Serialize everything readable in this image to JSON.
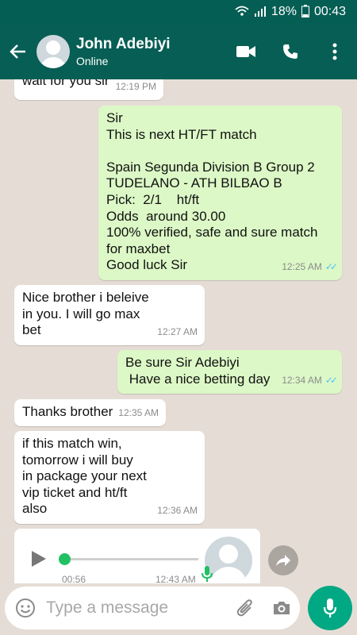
{
  "status_bar": {
    "battery": "18%",
    "time": "00:43"
  },
  "header": {
    "contact_name": "John Adebiyi",
    "status": "Online"
  },
  "messages": [
    {
      "dir": "in",
      "text": "wait for you sir",
      "time": "12:19 PM"
    },
    {
      "dir": "out",
      "text": "Sir\nThis is next HT/FT match\n\nSpain Segunda Division B Group 2\nTUDELANO - ATH BILBAO B\nPick:  2/1    ht/ft\nOdds  around 30.00\n100% verified, safe and sure match\nfor maxbet\nGood luck Sir",
      "time": "12:25 AM"
    },
    {
      "dir": "in",
      "text": "Nice brother i beleive\nin you. I will go max\nbet",
      "time": "12:27 AM"
    },
    {
      "dir": "out",
      "text": "Be sure Sir Adebiyi\n Have a nice betting day",
      "time": "12:34 AM"
    },
    {
      "dir": "in",
      "text": "Thanks brother",
      "time": "12:35 AM"
    },
    {
      "dir": "in",
      "text": "if this match win,\ntomorrow i will buy\nin package your next\nvip ticket and ht/ft\nalso",
      "time": "12:36 AM"
    }
  ],
  "voice_note": {
    "duration": "00:56",
    "time": "12:43 AM"
  },
  "composer": {
    "placeholder": "Type a message"
  },
  "colors": {
    "header": "#075e54",
    "status_bar": "#055e54",
    "outgoing_bubble": "#dcf8c6",
    "incoming_bubble": "#ffffff",
    "chat_background": "#e5ddd5",
    "read_ticks": "#4fc3f7",
    "mic_button": "#00a884",
    "voice_progress": "#21c063"
  },
  "icons": [
    "wifi-icon",
    "signal-icon",
    "battery-icon",
    "back-arrow-icon",
    "video-call-icon",
    "phone-icon",
    "more-vert-icon",
    "play-icon",
    "mic-icon",
    "forward-icon",
    "emoji-icon",
    "attach-icon",
    "camera-icon",
    "double-check-icon"
  ]
}
